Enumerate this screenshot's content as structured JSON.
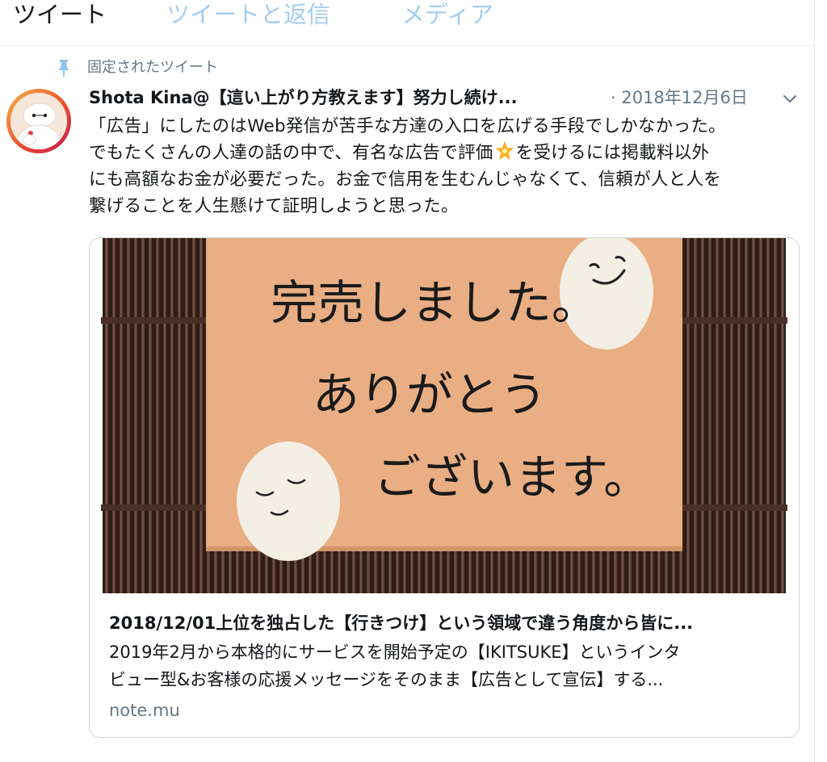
{
  "tabs": [
    {
      "label": "ツイート",
      "active": true
    },
    {
      "label": "ツイートと返信",
      "active": false
    },
    {
      "label": "メディア",
      "active": false
    }
  ],
  "pinned": {
    "label": "固定されたツイート",
    "icon": "pin-icon"
  },
  "tweet": {
    "author": "Shota Kina@【這い上がり方教えます】努力し続け...",
    "date": "· 2018年12月6日",
    "text_lines": [
      "「広告」にしたのはWeb発信が苦手な方達の入口を広げる手段でしかなかった。",
      "でもたくさんの人達の話の中で、有名な広告で評価",
      "を受けるには掲載料以外",
      "にも高額なお金が必要だった。お金で信用を生むんじゃなくて、信頼が人と人を",
      "繋げることを人生懸けて証明しようと思った。"
    ],
    "emoji": "glowing-star-icon"
  },
  "card": {
    "image_text": [
      "完売しました。",
      "ありがとう",
      "ございます。"
    ],
    "title": "2018/12/01上位を独占した【行きつけ】という領域で違う角度から皆に...",
    "description_lines": [
      "2019年2月から本格的にサービスを開始予定の【IKITSUKE】というインタ",
      "ビュー型&お客様の応援メッセージをそのまま【広告として宣伝】する..."
    ],
    "domain": "note.mu"
  },
  "colors": {
    "text": "#14171a",
    "secondary": "#657786",
    "accent_light": "#a3cdf0",
    "pin": "#8fc3ef",
    "border": "#ccd6dd"
  }
}
